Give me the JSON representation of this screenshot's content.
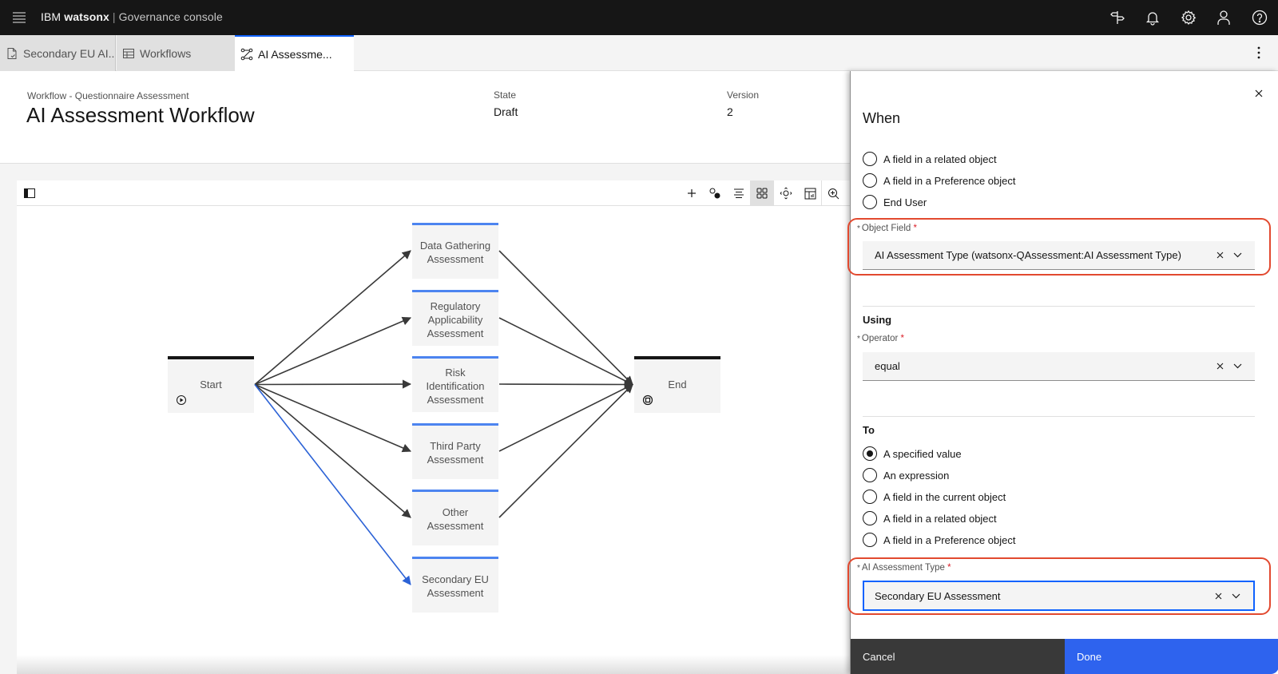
{
  "app": {
    "brand_ibm": "IBM",
    "brand_product": "watsonx",
    "brand_separator": "|",
    "brand_console": "Governance console"
  },
  "topbar_icons": [
    "signpost-icon",
    "notification-icon",
    "settings-icon",
    "user-icon",
    "help-icon"
  ],
  "tabs": [
    {
      "label": "Secondary EU AI...",
      "icon": "document-icon",
      "active": false
    },
    {
      "label": "Workflows",
      "icon": "table-icon",
      "active": false
    },
    {
      "label": "AI Assessme...",
      "icon": "workflow-icon",
      "active": true
    }
  ],
  "header": {
    "breadcrumb": "Workflow - Questionnaire Assessment",
    "title": "AI Assessment Workflow",
    "state_label": "State",
    "state_value": "Draft",
    "version_label": "Version",
    "version_value": "2"
  },
  "canvas_toolbar": {
    "tools": [
      "add-icon",
      "connect-icon",
      "align-icon",
      "grid-layout-icon",
      "fit-to-view-icon",
      "table-view-icon",
      "zoom-in-icon"
    ],
    "active_tool": "grid-layout-icon"
  },
  "workflow": {
    "nodes": [
      {
        "id": "start",
        "label": "Start",
        "type": "start"
      },
      {
        "id": "data",
        "label": "Data Gathering Assessment",
        "type": "task"
      },
      {
        "id": "reg",
        "label": "Regulatory Applicability Assessment",
        "type": "task"
      },
      {
        "id": "risk",
        "label": "Risk Identification Assessment",
        "type": "task"
      },
      {
        "id": "third",
        "label": "Third Party Assessment",
        "type": "task"
      },
      {
        "id": "other",
        "label": "Other Assessment",
        "type": "task"
      },
      {
        "id": "secondary",
        "label": "Secondary EU Assessment",
        "type": "task"
      },
      {
        "id": "end",
        "label": "End",
        "type": "end"
      }
    ],
    "edges": [
      {
        "from": "start",
        "to": "data",
        "selected": false
      },
      {
        "from": "start",
        "to": "reg",
        "selected": false
      },
      {
        "from": "start",
        "to": "risk",
        "selected": false
      },
      {
        "from": "start",
        "to": "third",
        "selected": false
      },
      {
        "from": "start",
        "to": "other",
        "selected": false
      },
      {
        "from": "start",
        "to": "secondary",
        "selected": true
      },
      {
        "from": "data",
        "to": "end",
        "selected": false
      },
      {
        "from": "reg",
        "to": "end",
        "selected": false
      },
      {
        "from": "risk",
        "to": "end",
        "selected": false
      },
      {
        "from": "third",
        "to": "end",
        "selected": false
      },
      {
        "from": "other",
        "to": "end",
        "selected": false
      }
    ],
    "edge_color": "#393939",
    "selected_edge_color": "#2c62d6"
  },
  "panel": {
    "when_title": "When",
    "when_options": [
      {
        "label": "A field in a related object",
        "checked": false
      },
      {
        "label": "A field in a Preference object",
        "checked": false
      },
      {
        "label": "End User",
        "checked": false
      }
    ],
    "object_field": {
      "label": "Object Field",
      "required_mark": "*",
      "value": "AI Assessment Type (watsonx-QAssessment:AI Assessment Type)"
    },
    "using_title": "Using",
    "operator": {
      "label": "Operator",
      "required_mark": "*",
      "value": "equal"
    },
    "to_title": "To",
    "to_options": [
      {
        "label": "A specified value",
        "checked": true
      },
      {
        "label": "An expression",
        "checked": false
      },
      {
        "label": "A field in the current object",
        "checked": false
      },
      {
        "label": "A field in a related object",
        "checked": false
      },
      {
        "label": "A field in a Preference object",
        "checked": false
      }
    ],
    "assessment_type": {
      "label": "AI Assessment Type",
      "required_mark": "*",
      "value": "Secondary EU Assessment"
    },
    "cancel_label": "Cancel",
    "done_label": "Done",
    "highlight_color": "#e2492f"
  }
}
